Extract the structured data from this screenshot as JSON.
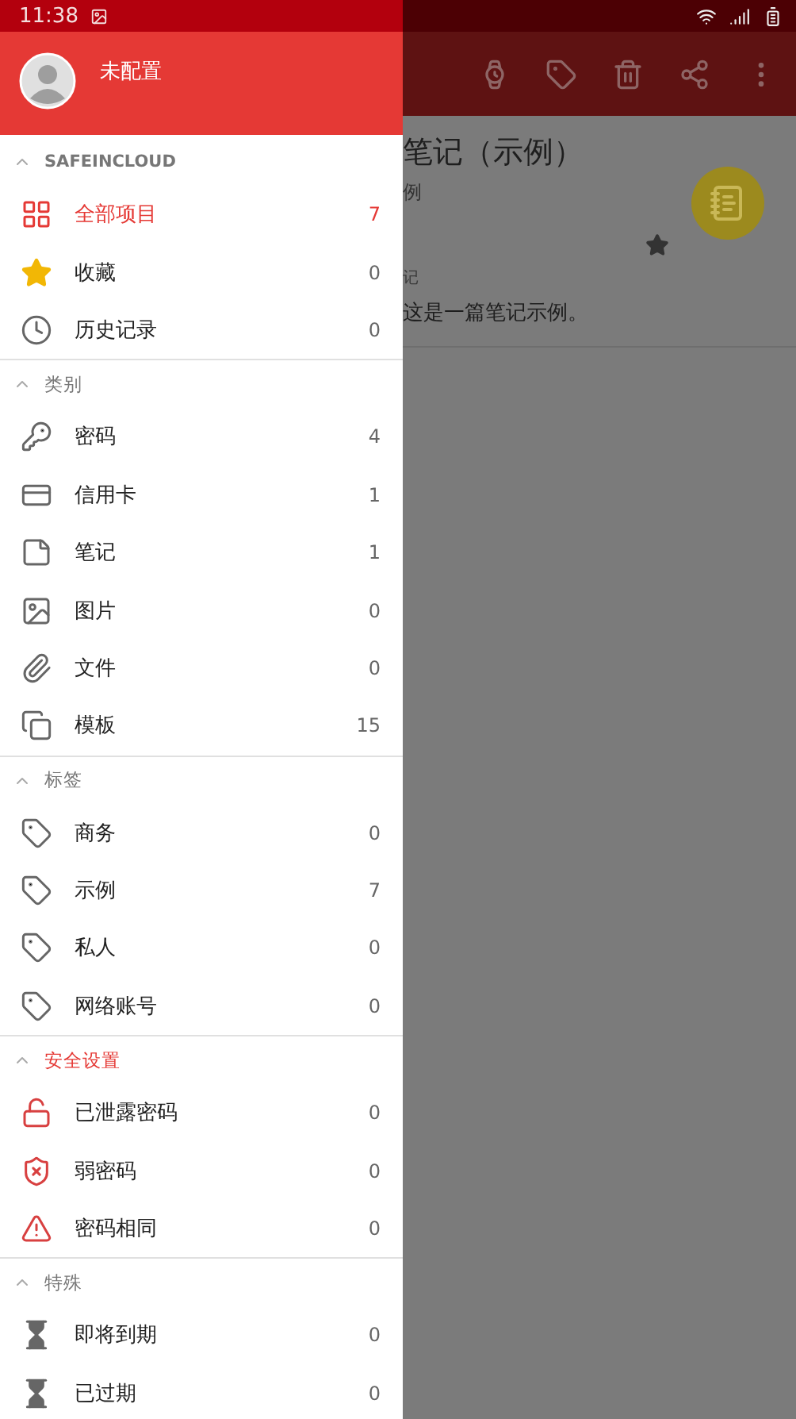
{
  "status_bar": {
    "time": "11:38"
  },
  "drawer": {
    "account": {
      "name": "未配置"
    },
    "sections": [
      {
        "title": "SAFEINCLOUD",
        "alert": false,
        "items": [
          {
            "label": "全部项目",
            "count": "7",
            "selected": true
          },
          {
            "label": "收藏",
            "count": "0",
            "selected": false
          },
          {
            "label": "历史记录",
            "count": "0",
            "selected": false
          }
        ]
      },
      {
        "title": "类别",
        "alert": false,
        "items": [
          {
            "label": "密码",
            "count": "4",
            "selected": false
          },
          {
            "label": "信用卡",
            "count": "1",
            "selected": false
          },
          {
            "label": "笔记",
            "count": "1",
            "selected": false
          },
          {
            "label": "图片",
            "count": "0",
            "selected": false
          },
          {
            "label": "文件",
            "count": "0",
            "selected": false
          },
          {
            "label": "模板",
            "count": "15",
            "selected": false
          }
        ]
      },
      {
        "title": "标签",
        "alert": false,
        "items": [
          {
            "label": "商务",
            "count": "0",
            "selected": false
          },
          {
            "label": "示例",
            "count": "7",
            "selected": false
          },
          {
            "label": "私人",
            "count": "0",
            "selected": false
          },
          {
            "label": "网络账号",
            "count": "0",
            "selected": false
          }
        ]
      },
      {
        "title": "安全设置",
        "alert": true,
        "items": [
          {
            "label": "已泄露密码",
            "count": "0",
            "selected": false
          },
          {
            "label": "弱密码",
            "count": "0",
            "selected": false
          },
          {
            "label": "密码相同",
            "count": "0",
            "selected": false
          }
        ]
      },
      {
        "title": "特殊",
        "alert": false,
        "items": [
          {
            "label": "即将到期",
            "count": "0",
            "selected": false
          },
          {
            "label": "已过期",
            "count": "0",
            "selected": false
          }
        ]
      }
    ]
  },
  "card": {
    "title": "笔记（示例）",
    "subtitle": "例",
    "starred": true,
    "field_label": "记",
    "field_value": "这是一篇笔记示例。"
  }
}
